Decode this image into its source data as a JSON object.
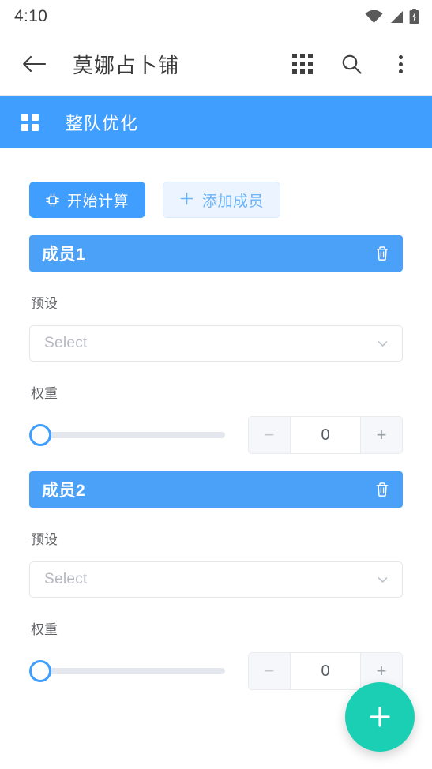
{
  "status_bar": {
    "time": "4:10",
    "icons": [
      "wifi-icon",
      "signal-icon",
      "battery-charging-icon"
    ]
  },
  "app_bar": {
    "back_icon": "back-arrow-icon",
    "title": "莫娜占卜铺",
    "actions": [
      "apps-grid-icon",
      "search-icon",
      "overflow-menu-icon"
    ]
  },
  "section": {
    "icon": "grid-2x2-icon",
    "title": "整队优化"
  },
  "toolbar": {
    "calculate_label": "开始计算",
    "calculate_icon": "chip-icon",
    "add_member_label": "添加成员",
    "add_member_icon": "plus-icon"
  },
  "labels": {
    "preset": "预设",
    "weight": "权重",
    "select_placeholder": "Select",
    "delete_icon": "trash-icon",
    "chevron_icon": "chevron-down-icon",
    "minus_label": "−",
    "plus_label": "+"
  },
  "members": [
    {
      "name": "成员1",
      "preset": "Select",
      "weight": 0,
      "slider_percent": 0
    },
    {
      "name": "成员2",
      "preset": "Select",
      "weight": 0,
      "slider_percent": 0
    }
  ],
  "fab": {
    "icon": "plus-icon",
    "color": "#1bcfb4"
  },
  "colors": {
    "primary_blue": "#409eff",
    "header_blue": "#4ba0f8",
    "ghost_bg": "#ecf5ff",
    "fab_teal": "#1bcfb4",
    "track_gray": "#e4e7ed"
  }
}
